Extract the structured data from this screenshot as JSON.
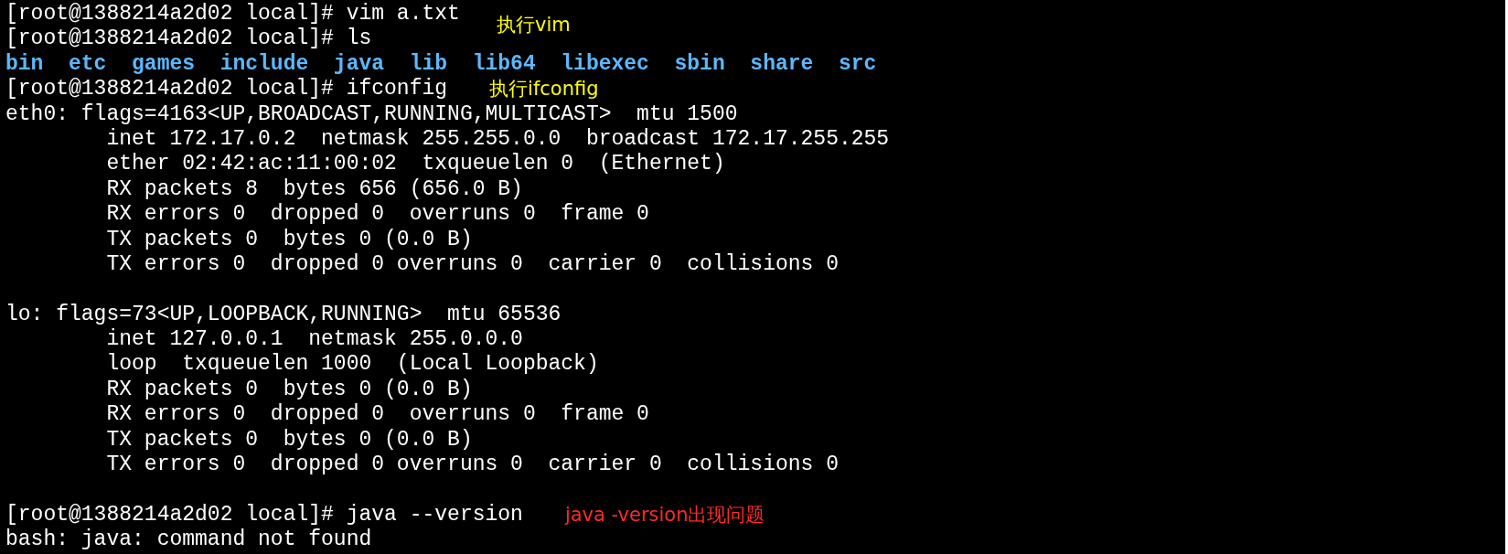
{
  "terminal": {
    "lines": [
      {
        "kind": "prompt",
        "prompt": "[root@1388214a2d02 local]#",
        "command": "vim a.txt",
        "note": {
          "text": "执行vim",
          "color": "#ffff00",
          "kind": "below"
        }
      },
      {
        "kind": "prompt",
        "prompt": "[root@1388214a2d02 local]#",
        "command": "ls"
      },
      {
        "kind": "listing",
        "entries": [
          "bin",
          "etc",
          "games",
          "include",
          "java",
          "lib",
          "lib64",
          "libexec",
          "sbin",
          "share",
          "src"
        ]
      },
      {
        "kind": "prompt",
        "prompt": "[root@1388214a2d02 local]#",
        "command": "ifconfig",
        "note": {
          "text": "执行ifconfig",
          "color": "#ffff00",
          "kind": "inline"
        }
      },
      {
        "kind": "output",
        "text": "eth0: flags=4163<UP,BROADCAST,RUNNING,MULTICAST>  mtu 1500"
      },
      {
        "kind": "output",
        "text": "        inet 172.17.0.2  netmask 255.255.0.0  broadcast 172.17.255.255"
      },
      {
        "kind": "output",
        "text": "        ether 02:42:ac:11:00:02  txqueuelen 0  (Ethernet)"
      },
      {
        "kind": "output",
        "text": "        RX packets 8  bytes 656 (656.0 B)"
      },
      {
        "kind": "output",
        "text": "        RX errors 0  dropped 0  overruns 0  frame 0"
      },
      {
        "kind": "output",
        "text": "        TX packets 0  bytes 0 (0.0 B)"
      },
      {
        "kind": "output",
        "text": "        TX errors 0  dropped 0 overruns 0  carrier 0  collisions 0"
      },
      {
        "kind": "blank"
      },
      {
        "kind": "output",
        "text": "lo: flags=73<UP,LOOPBACK,RUNNING>  mtu 65536"
      },
      {
        "kind": "output",
        "text": "        inet 127.0.0.1  netmask 255.0.0.0"
      },
      {
        "kind": "output",
        "text": "        loop  txqueuelen 1000  (Local Loopback)"
      },
      {
        "kind": "output",
        "text": "        RX packets 0  bytes 0 (0.0 B)"
      },
      {
        "kind": "output",
        "text": "        RX errors 0  dropped 0  overruns 0  frame 0"
      },
      {
        "kind": "output",
        "text": "        TX packets 0  bytes 0 (0.0 B)"
      },
      {
        "kind": "output",
        "text": "        TX errors 0  dropped 0 overruns 0  carrier 0  collisions 0"
      },
      {
        "kind": "blank"
      },
      {
        "kind": "prompt",
        "prompt": "[root@1388214a2d02 local]#",
        "command": "java --version",
        "note": {
          "text": "java -version出现问题",
          "color": "#ff2a2a",
          "kind": "inline"
        }
      },
      {
        "kind": "output",
        "text": "bash: java: command not found"
      }
    ]
  }
}
